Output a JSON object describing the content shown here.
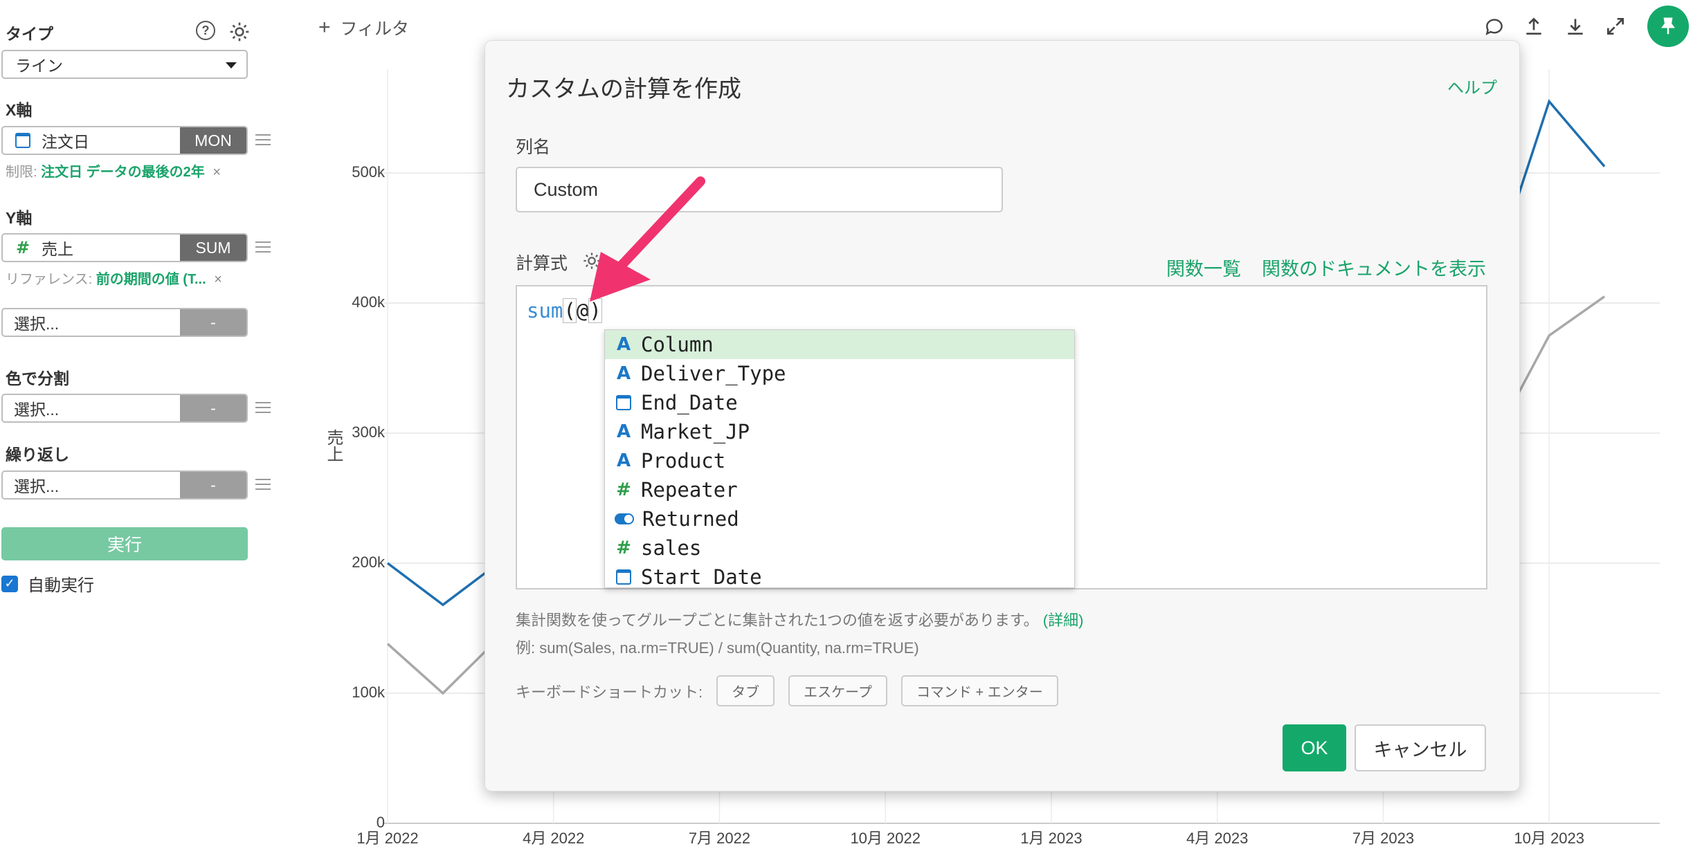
{
  "sidebar": {
    "type_label": "タイプ",
    "type_value": "ライン",
    "x_axis_label": "X軸",
    "x_field": "注文日",
    "x_agg": "MON",
    "x_limit_prefix": "制限:",
    "x_limit_value": "注文日 データの最後の2年",
    "y_axis_label": "Y軸",
    "y_field": "売上",
    "y_agg": "SUM",
    "y_ref_prefix": "リファレンス:",
    "y_ref_value": "前の期間の値 (T...",
    "extra_select": "選択...",
    "extra_tag": "-",
    "color_label": "色で分割",
    "color_select": "選択...",
    "color_tag": "-",
    "repeat_label": "繰り返し",
    "repeat_select": "選択...",
    "repeat_tag": "-",
    "run_label": "実行",
    "auto_run_label": "自動実行",
    "close_x": "×",
    "help_q": "?"
  },
  "topbar": {
    "filter_label": "フィルタ",
    "plus": "+"
  },
  "chart_data": {
    "type": "line",
    "ylabel": "売上",
    "y_ticks": [
      "0",
      "100k",
      "200k",
      "300k",
      "400k",
      "500k"
    ],
    "x_ticks": [
      "1月 2022",
      "4月 2022",
      "7月 2022",
      "10月 2022",
      "1月 2023",
      "4月 2023",
      "7月 2023",
      "10月 2023"
    ],
    "ylim": [
      0,
      500000
    ],
    "grid": true,
    "series": [
      {
        "color": "#1f6fb0",
        "points_visible": [
          [
            "2022-01",
            200000
          ],
          [
            "2022-02",
            168000
          ],
          [
            "2022-03",
            200000
          ],
          [
            "2023-08",
            455000
          ],
          [
            "2023-09",
            425000
          ],
          [
            "2023-10",
            555000
          ],
          [
            "2023-11",
            505000
          ]
        ]
      },
      {
        "color": "#a8a8a8",
        "points_visible": [
          [
            "2022-01",
            138000
          ],
          [
            "2022-02",
            100000
          ],
          [
            "2022-03",
            142000
          ],
          [
            "2023-08",
            340000
          ],
          [
            "2023-09",
            295000
          ],
          [
            "2023-10",
            375000
          ],
          [
            "2023-11",
            405000
          ]
        ]
      }
    ]
  },
  "modal": {
    "title": "カスタムの計算を作成",
    "help": "ヘルプ",
    "column_name_label": "列名",
    "column_name_value": "Custom",
    "formula_label": "計算式",
    "func_list_link": "関数一覧",
    "func_doc_link": "関数のドキュメントを表示",
    "code_fn": "sum",
    "code_open": "(",
    "code_cursor": "@",
    "code_close": ")",
    "autocomplete": [
      {
        "icon": "text-icon",
        "label": "Column",
        "selected": true
      },
      {
        "icon": "text-icon",
        "label": "Deliver_Type"
      },
      {
        "icon": "calendar-icon",
        "label": "End_Date"
      },
      {
        "icon": "text-icon",
        "label": "Market_JP"
      },
      {
        "icon": "text-icon",
        "label": "Product"
      },
      {
        "icon": "number-icon",
        "label": "Repeater"
      },
      {
        "icon": "toggle-icon",
        "label": "Returned"
      },
      {
        "icon": "number-icon",
        "label": "sales"
      },
      {
        "icon": "calendar-icon",
        "label": "Start_Date"
      }
    ],
    "note_text": "集計関数を使ってグループごとに集計された1つの値を返す必要があります。",
    "note_link": "(詳細)",
    "example": "例: sum(Sales, na.rm=TRUE) / sum(Quantity, na.rm=TRUE)",
    "kb_label": "キーボードショートカット:",
    "kb_tab": "タブ",
    "kb_escape": "エスケープ",
    "kb_cmd_enter": "コマンド + エンター",
    "ok_label": "OK",
    "cancel_label": "キャンセル"
  },
  "colors": {
    "accent": "#14a96a",
    "annotation_arrow": "#f0336e"
  }
}
